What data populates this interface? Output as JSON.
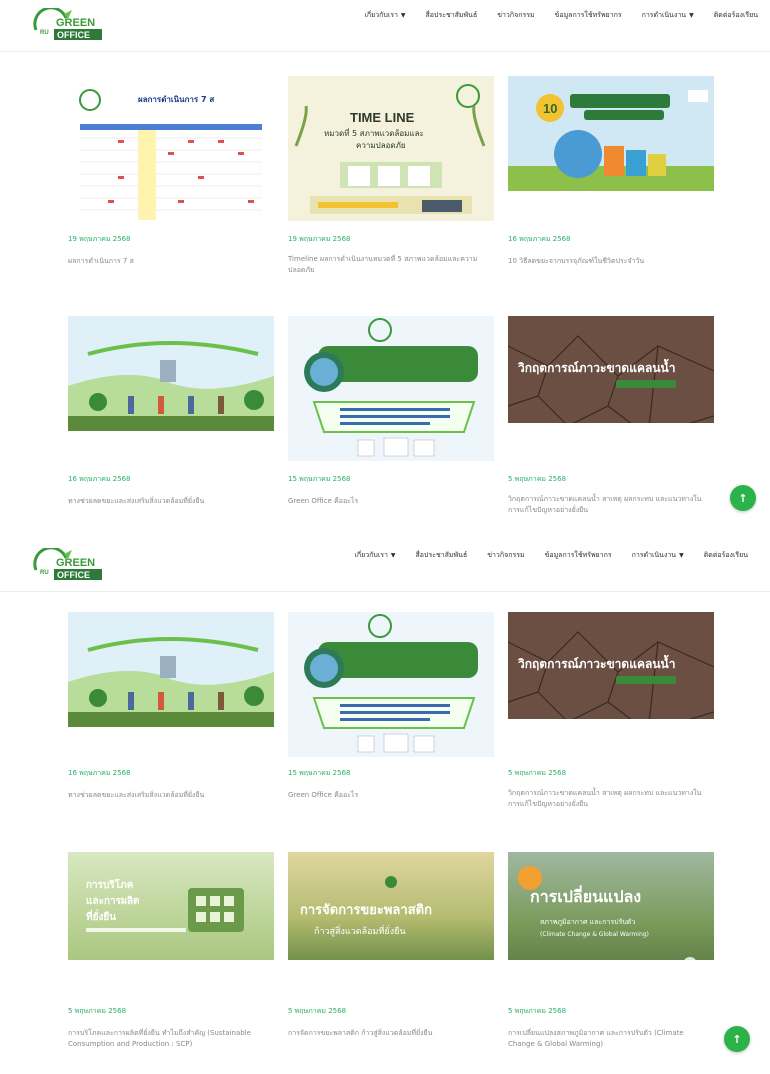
{
  "logo": {
    "word1": "GREEN",
    "word2": "OFFICE",
    "prefix": "RU"
  },
  "nav": [
    {
      "label": "เกี่ยวกับเรา",
      "dropdown": true
    },
    {
      "label": "สื่อประชาสัมพันธ์",
      "dropdown": false
    },
    {
      "label": "ข่าวกิจกรรม",
      "dropdown": false
    },
    {
      "label": "ข้อมูลการใช้ทรัพยากร",
      "dropdown": false
    },
    {
      "label": "การดำเนินงาน",
      "dropdown": true
    },
    {
      "label": "ติดต่อร้องเรียน",
      "dropdown": false
    }
  ],
  "posts": [
    {
      "date": "19 พฤษภาคม 2568",
      "excerpt": "ผลการดำเนินการ 7 ส"
    },
    {
      "date": "19 พฤษภาคม 2568",
      "excerpt": "Timeline ผลการดำเนินงานหมวดที่ 5 สภาพแวดล้อมและความปลอดภัย"
    },
    {
      "date": "16 พฤษภาคม 2568",
      "excerpt": "10 วิธีลดขยะจากบรรจุภัณฑ์ในชีวิตประจำวัน"
    },
    {
      "date": "16 พฤษภาคม 2568",
      "excerpt": "ทางช่วยลดขยะและส่งเสริมสิ่งแวดล้อมที่ยั่งยืน"
    },
    {
      "date": "15 พฤษภาคม 2568",
      "excerpt": "Green Office คืออะไร"
    },
    {
      "date": "5 พฤษภาคม 2568",
      "excerpt": "วิกฤตการณ์ภาวะขาดแคลนน้ำ สาเหตุ ผลกระทบ และแนวทางในการแก้ไขปัญหาอย่างยั่งยืน"
    },
    {
      "date": "5 พฤษภาคม 2568",
      "excerpt": "การบริโภคและการผลิตที่ยั่งยืน ทำไมถึงสำคัญ (Sustainable Consumption and Production : SCP)"
    },
    {
      "date": "5 พฤษภาคม 2568",
      "excerpt": "การจัดการขยะพลาสติก ก้าวสู่สิ่งแวดล้อมที่ยั่งยืน"
    },
    {
      "date": "5 พฤษภาคม 2568",
      "excerpt": "การเปลี่ยนแปลงสภาพภูมิอากาศ และการปรับตัว (Climate Change & Global Warming)"
    }
  ],
  "thumbs": {
    "t1_title": "ผลการดำเนินการ 7 ส",
    "t2_title": "TIME LINE",
    "t2_sub1": "หมวดที่ 5 สภาพแวดล้อมและ",
    "t2_sub2": "ความปลอดภัย",
    "t3_badge": "10",
    "t6_title": "วิกฤตการณ์ภาวะขาดแคลนน้ำ",
    "t7_l1": "การบริโภค",
    "t7_l2": "และการผลิต",
    "t7_l3": "ที่ยั่งยืน",
    "t8_title": "การจัดการขยะพลาสติก",
    "t8_sub": "ก้าวสู่สิ่งแวดล้อมที่ยั่งยืน",
    "t9_l1": "การเปลี่ยนแปลง",
    "t9_l2": "สภาพภูมิอากาศ และการปรับตัว",
    "t9_l3": "(Climate Change & Global Warming)"
  },
  "fab_label": "↑",
  "colors": {
    "accent": "#2ab06a",
    "fab": "#2bb34a",
    "brand_green": "#3a9a3a"
  }
}
